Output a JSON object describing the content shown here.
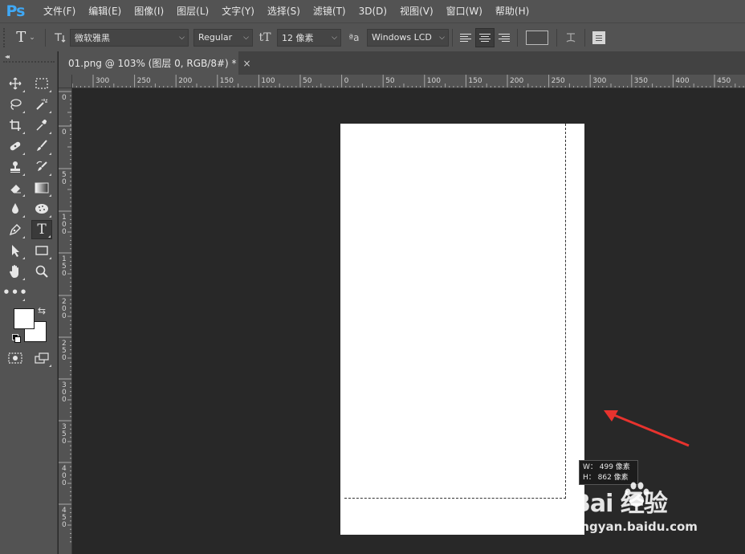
{
  "app": {
    "logo": "Ps"
  },
  "menu": [
    {
      "label": "文件(F)"
    },
    {
      "label": "编辑(E)"
    },
    {
      "label": "图像(I)"
    },
    {
      "label": "图层(L)"
    },
    {
      "label": "文字(Y)"
    },
    {
      "label": "选择(S)"
    },
    {
      "label": "滤镜(T)"
    },
    {
      "label": "3D(D)"
    },
    {
      "label": "视图(V)"
    },
    {
      "label": "窗口(W)"
    },
    {
      "label": "帮助(H)"
    }
  ],
  "options": {
    "tool_glyph": "T",
    "font_family": "微软雅黑",
    "font_style": "Regular",
    "font_size": "12 像素",
    "antialias_glyph": "ªa",
    "antialias": "Windows LCD",
    "size_glyph": "tT",
    "text_color": "#4a4a4a"
  },
  "document": {
    "tab_title": "01.png @ 103% (图层 0, RGB/8#) *",
    "close_glyph": "×"
  },
  "rulers": {
    "horizontal_labels": [
      "300",
      "250",
      "200",
      "150",
      "100",
      "50",
      "0",
      "50",
      "100",
      "150",
      "200",
      "250",
      "300",
      "350",
      "400",
      "450"
    ],
    "vertical_labels": [
      "0",
      "0",
      "50",
      "100",
      "150",
      "200",
      "250",
      "300",
      "350",
      "400",
      "450"
    ]
  },
  "canvas": {
    "size_tooltip": {
      "w": "W： 499 像素",
      "h": "H： 862 像素"
    }
  },
  "annotation": {
    "color": "#e8332e"
  },
  "watermark": {
    "brand": "Bai  经验",
    "sub": "jingyan.baidu.com"
  },
  "colors": {
    "foreground": "#ffffff",
    "background": "#ffffff"
  }
}
